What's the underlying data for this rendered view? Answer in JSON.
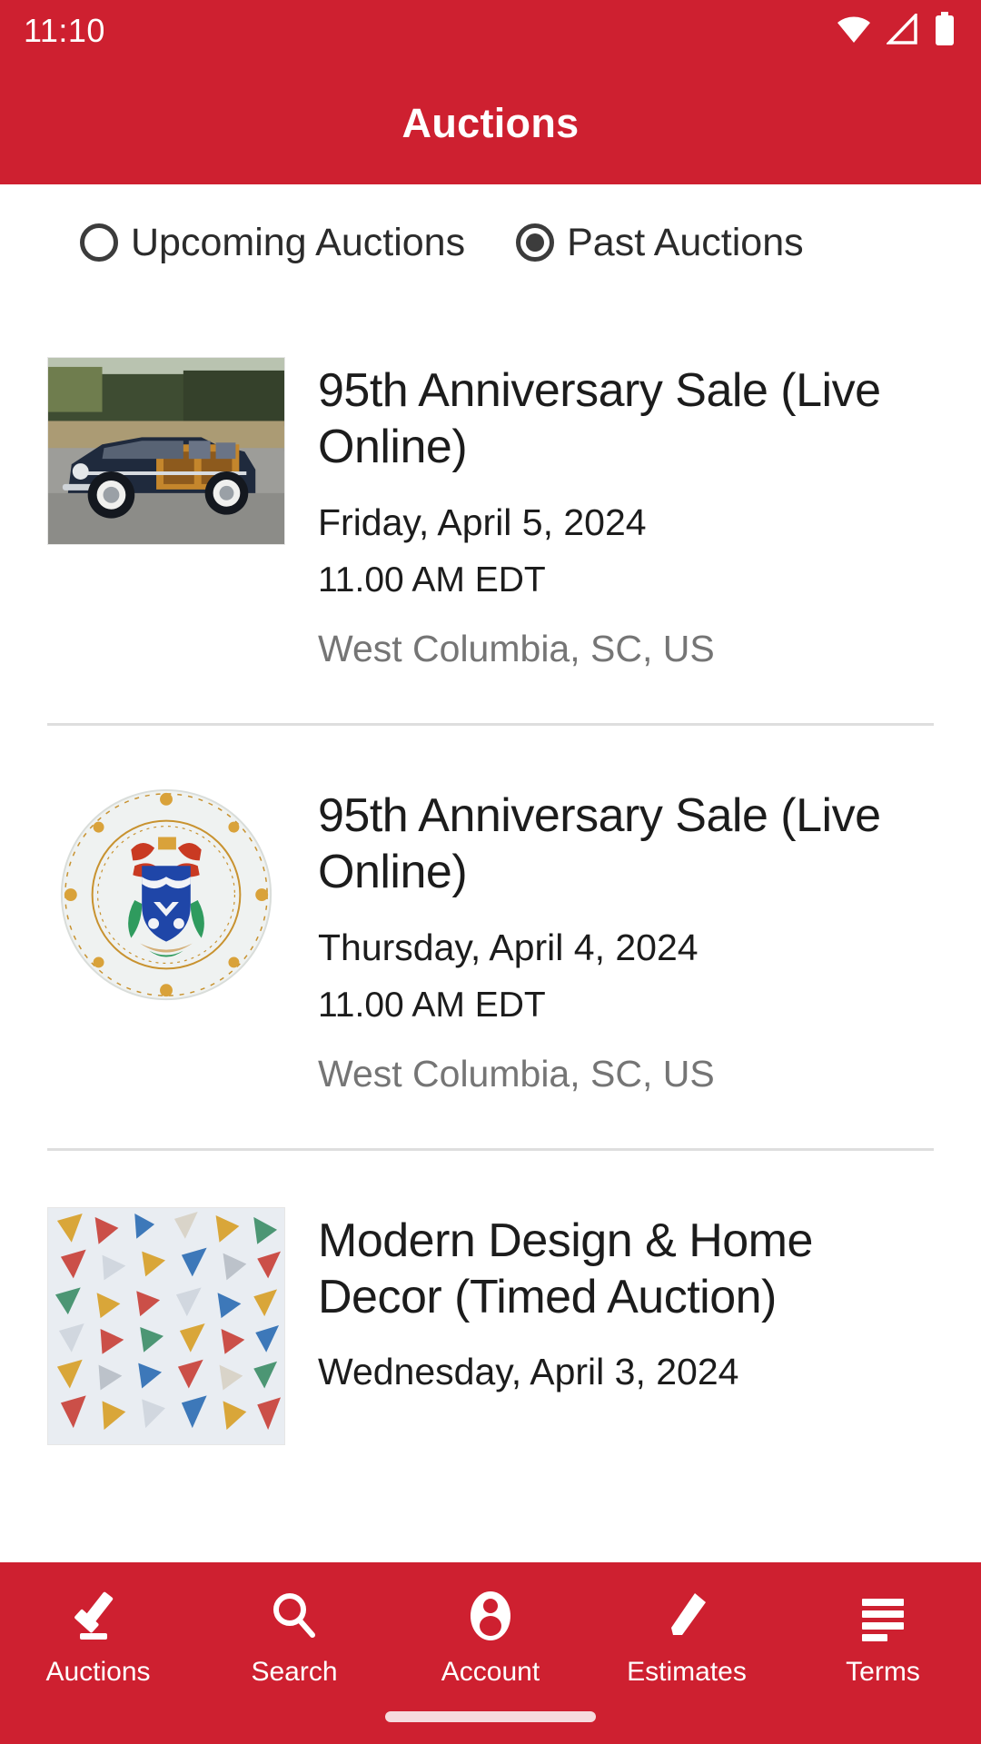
{
  "status_bar": {
    "time": "11:10",
    "icons": [
      "wifi-icon",
      "cellular-signal-icon",
      "battery-icon"
    ]
  },
  "app_bar": {
    "title": "Auctions",
    "background_color": "#ce2030"
  },
  "filter": {
    "options": [
      {
        "label": "Upcoming Auctions",
        "selected": false,
        "name": "radio-upcoming-auctions"
      },
      {
        "label": "Past Auctions",
        "selected": true,
        "name": "radio-past-auctions"
      }
    ]
  },
  "auctions": [
    {
      "title": "95th Anniversary Sale (Live Online)",
      "date": "Friday, April 5, 2024",
      "time": "11.00 AM EDT",
      "location": "West Columbia, SC, US",
      "thumbnail": "vintage-woody-wagon-photo"
    },
    {
      "title": "95th Anniversary Sale (Live Online)",
      "date": "Thursday, April 4, 2024",
      "time": "11.00 AM EDT",
      "location": "West Columbia, SC, US",
      "thumbnail": "armorial-porcelain-plate-photo"
    },
    {
      "title": "Modern Design & Home Decor (Timed Auction)",
      "date": "Wednesday, April 3, 2024",
      "time": "",
      "location": "",
      "thumbnail": "abstract-shard-painting-photo"
    }
  ],
  "bottom_nav": {
    "items": [
      {
        "label": "Auctions",
        "icon": "gavel-icon",
        "active": true
      },
      {
        "label": "Search",
        "icon": "search-icon",
        "active": false
      },
      {
        "label": "Account",
        "icon": "account-icon",
        "active": false
      },
      {
        "label": "Estimates",
        "icon": "pencil-icon",
        "active": false
      },
      {
        "label": "Terms",
        "icon": "list-lines-icon",
        "active": false
      }
    ]
  },
  "colors": {
    "brand_red": "#ce2030",
    "text_primary": "#1c1c1c",
    "text_muted": "#757575",
    "divider": "#dedede"
  }
}
